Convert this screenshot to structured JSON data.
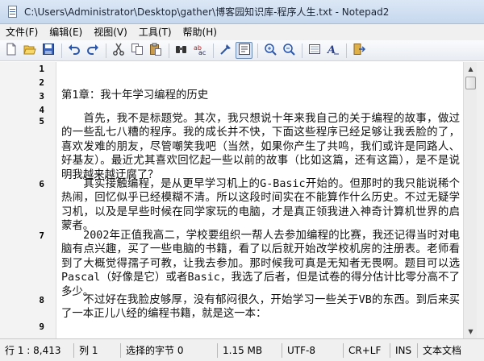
{
  "window": {
    "title": "C:\\Users\\Administrator\\Desktop\\gather\\博客园知识库-程序人生.txt - Notepad2"
  },
  "menu": [
    {
      "label": "文件(F)"
    },
    {
      "label": "编辑(E)"
    },
    {
      "label": "视图(V)"
    },
    {
      "label": "工具(T)"
    },
    {
      "label": "帮助(H)"
    }
  ],
  "toolbar": {
    "buttons": [
      "new-icon",
      "open-icon",
      "save-icon",
      "undo-icon",
      "redo-icon",
      "cut-icon",
      "copy-icon",
      "paste-icon",
      "find-icon",
      "replace-icon",
      "wrap-icon",
      "word-wrap-icon",
      "zoom-in-icon",
      "zoom-out-icon",
      "scheme-icon",
      "font-icon",
      "exit-icon"
    ],
    "pressed": "word-wrap-icon"
  },
  "editor": {
    "line_numbers": [
      "1",
      "2",
      "3",
      "4",
      "5",
      "6",
      "7",
      "8",
      "9"
    ],
    "lines": [
      "第1章：我十年学习编程的历史",
      "　　首先，我不是标题党。其次，我只想说十年来我自己的关于编程的故事，做过的一些乱七八糟的程序。我的成长并不快，下面这些程序已经足够让我丢脸的了，喜欢发难的朋友，尽管嘲笑我吧（当然，如果你产生了共鸣，我们或许是同路人、好基友）。最近尤其喜欢回忆起一些以前的故事（比如这篇，还有这篇），是不是说明我越来越迂腐了？",
      "　　其实接触编程，是从更早学习机上的G-Basic开始的。但那时的我只能说稀个热闹，回忆似乎已经模糊不清。所以这段时间实在不能算作什么历史。不过无疑学习机，以及是早些时候在同学家玩的电脑，才是真正领我进入神奇计算机世界的启蒙者。",
      "　　2002年正值我高二，学校要组织一帮人去参加编程的比赛，我还记得当时对电脑有点兴趣，买了一些电脑的书籍，看了以后就开始改学校机房的注册表。老师看到了大概觉得孺子可教，让我去参加。那时候我可真是无知者无畏啊。题目可以选Pascal（好像是它）或者Basic，我选了后者，但是试卷的得分估计比零分高不了多少。",
      "　　不过好在我脸皮够厚，没有郁闷很久，开始学习一些关于VB的东西。到后来买了一本正儿八经的编程书籍，就是这一本："
    ]
  },
  "status": {
    "position": "行 1 : 8,413",
    "column": "列 1",
    "selection": "选择的字节 0",
    "size": "1.15 MB",
    "encoding": "UTF-8",
    "eol": "CR+LF",
    "mode": "INS",
    "doctype": "文本文档"
  }
}
